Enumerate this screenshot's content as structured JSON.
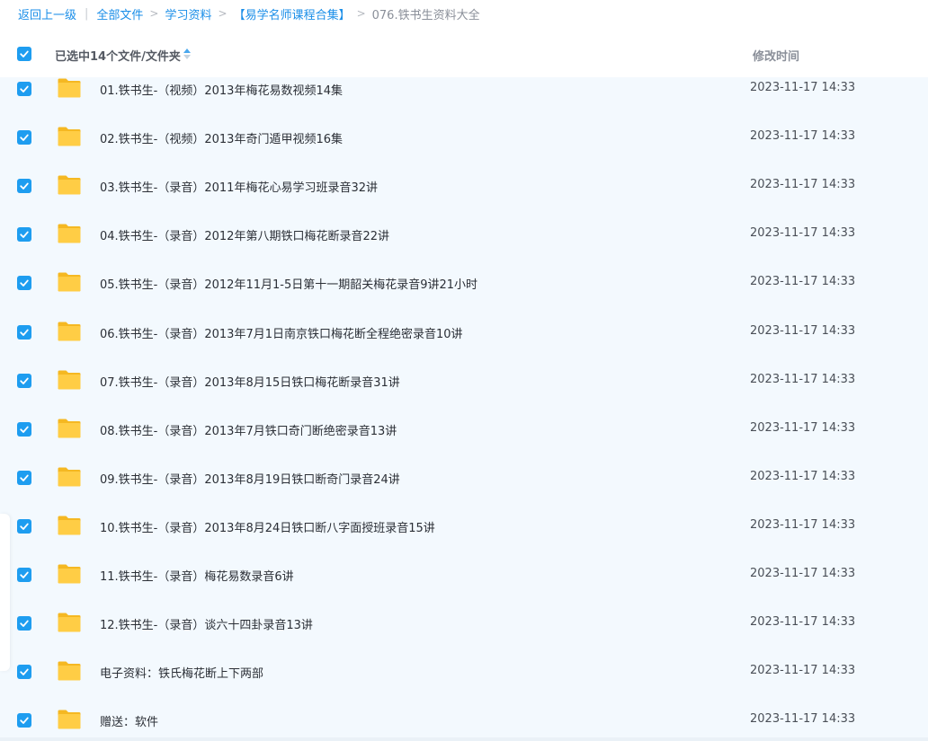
{
  "breadcrumb": {
    "back": "返回上一级",
    "all_files": "全部文件",
    "level1": "学习资料",
    "level2": "【易学名师课程合集】",
    "current": "076.铁书生资料大全"
  },
  "header": {
    "selection_label": "已选中14个文件/文件夹",
    "modified_time_label": "修改时间"
  },
  "colors": {
    "accent": "#1e9df0",
    "link": "#1a8ee8",
    "folder": "#ffc93c",
    "row_bg": "#f3f9fe"
  },
  "files": [
    {
      "name": "01.铁书生-（视频）2013年梅花易数视频14集",
      "time": "2023-11-17 14:33"
    },
    {
      "name": "02.铁书生-（视频）2013年奇门遁甲视频16集",
      "time": "2023-11-17 14:33"
    },
    {
      "name": "03.铁书生-（录音）2011年梅花心易学习班录音32讲",
      "time": "2023-11-17 14:33"
    },
    {
      "name": "04.铁书生-（录音）2012年第八期铁口梅花断录音22讲",
      "time": "2023-11-17 14:33"
    },
    {
      "name": "05.铁书生-（录音）2012年11月1-5日第十一期韶关梅花录音9讲21小时",
      "time": "2023-11-17 14:33"
    },
    {
      "name": "06.铁书生-（录音）2013年7月1日南京铁口梅花断全程绝密录音10讲",
      "time": "2023-11-17 14:33"
    },
    {
      "name": "07.铁书生-（录音）2013年8月15日铁口梅花断录音31讲",
      "time": "2023-11-17 14:33"
    },
    {
      "name": "08.铁书生-（录音）2013年7月铁口奇门断绝密录音13讲",
      "time": "2023-11-17 14:33"
    },
    {
      "name": "09.铁书生-（录音）2013年8月19日铁口断奇门录音24讲",
      "time": "2023-11-17 14:33"
    },
    {
      "name": "10.铁书生-（录音）2013年8月24日铁口断八字面授班录音15讲",
      "time": "2023-11-17 14:33"
    },
    {
      "name": "11.铁书生-（录音）梅花易数录音6讲",
      "time": "2023-11-17 14:33"
    },
    {
      "name": "12.铁书生-（录音）谈六十四卦录音13讲",
      "time": "2023-11-17 14:33"
    },
    {
      "name": "电子资料：铁氏梅花断上下两部",
      "time": "2023-11-17 14:33"
    },
    {
      "name": "赠送：软件",
      "time": "2023-11-17 14:33"
    }
  ]
}
